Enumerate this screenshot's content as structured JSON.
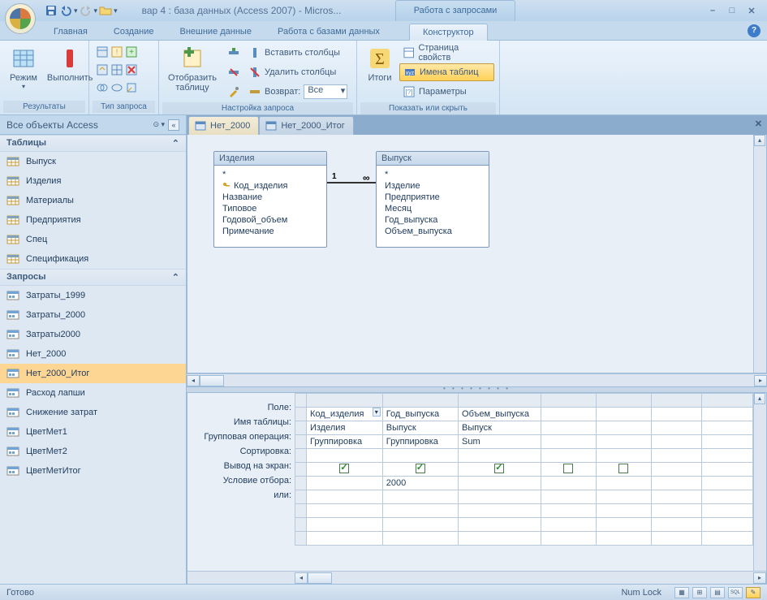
{
  "window": {
    "title": "вар 4 : база данных (Access 2007) - Micros...",
    "context_tools": "Работа с запросами"
  },
  "tabs": {
    "home": "Главная",
    "create": "Создание",
    "external": "Внешние данные",
    "database_tools": "Работа с базами данных",
    "design": "Конструктор"
  },
  "ribbon": {
    "group_results": "Результаты",
    "view": "Режим",
    "run": "Выполнить",
    "group_querytype": "Тип запроса",
    "group_setup": "Настройка запроса",
    "show_table": "Отобразить\nтаблицу",
    "insert_cols": "Вставить столбцы",
    "delete_cols": "Удалить столбцы",
    "return": "Возврат:",
    "return_val": "Все",
    "group_showhide": "Показать или скрыть",
    "totals": "Итоги",
    "prop_sheet": "Страница свойств",
    "table_names": "Имена таблиц",
    "parameters": "Параметры"
  },
  "nav": {
    "title": "Все объекты Access",
    "tables_hdr": "Таблицы",
    "queries_hdr": "Запросы",
    "tables": [
      "Выпуск",
      "Изделия",
      "Материалы",
      "Предприятия",
      "Спец",
      "Спецификация"
    ],
    "queries": [
      "Затраты_1999",
      "Затраты_2000",
      "Затраты2000",
      "Нет_2000",
      "Нет_2000_Итог",
      "Расход лапши",
      "Снижение затрат",
      "ЦветМет1",
      "ЦветМет2",
      "ЦветМетИтог"
    ],
    "selected_query": "Нет_2000_Итог"
  },
  "doc_tabs": {
    "tab1": "Нет_2000",
    "tab2": "Нет_2000_Итог"
  },
  "tablebox1": {
    "title": "Изделия",
    "star": "*",
    "fields": [
      "Код_изделия",
      "Название",
      "Типовое",
      "Годовой_объем",
      "Примечание"
    ]
  },
  "tablebox2": {
    "title": "Выпуск",
    "star": "*",
    "fields": [
      "Изделие",
      "Предприятие",
      "Месяц",
      "Год_выпуска",
      "Объем_выпуска"
    ]
  },
  "relation": {
    "left": "1",
    "right": "∞"
  },
  "grid_rows": {
    "field": "Поле:",
    "table": "Имя таблицы:",
    "total": "Групповая операция:",
    "sort": "Сортировка:",
    "show": "Вывод на экран:",
    "criteria": "Условие отбора:",
    "or": "или:"
  },
  "grid_data": {
    "cols": [
      {
        "field": "Код_изделия",
        "table": "Изделия",
        "total": "Группировка",
        "show": true,
        "criteria": ""
      },
      {
        "field": "Год_выпуска",
        "table": "Выпуск",
        "total": "Группировка",
        "show": true,
        "criteria": "2000"
      },
      {
        "field": "Объем_выпуска",
        "table": "Выпуск",
        "total": "Sum",
        "show": true,
        "criteria": ""
      },
      {
        "field": "",
        "table": "",
        "total": "",
        "show": false,
        "criteria": ""
      },
      {
        "field": "",
        "table": "",
        "total": "",
        "show": false,
        "criteria": ""
      }
    ]
  },
  "status": {
    "ready": "Готово",
    "numlock": "Num Lock"
  }
}
